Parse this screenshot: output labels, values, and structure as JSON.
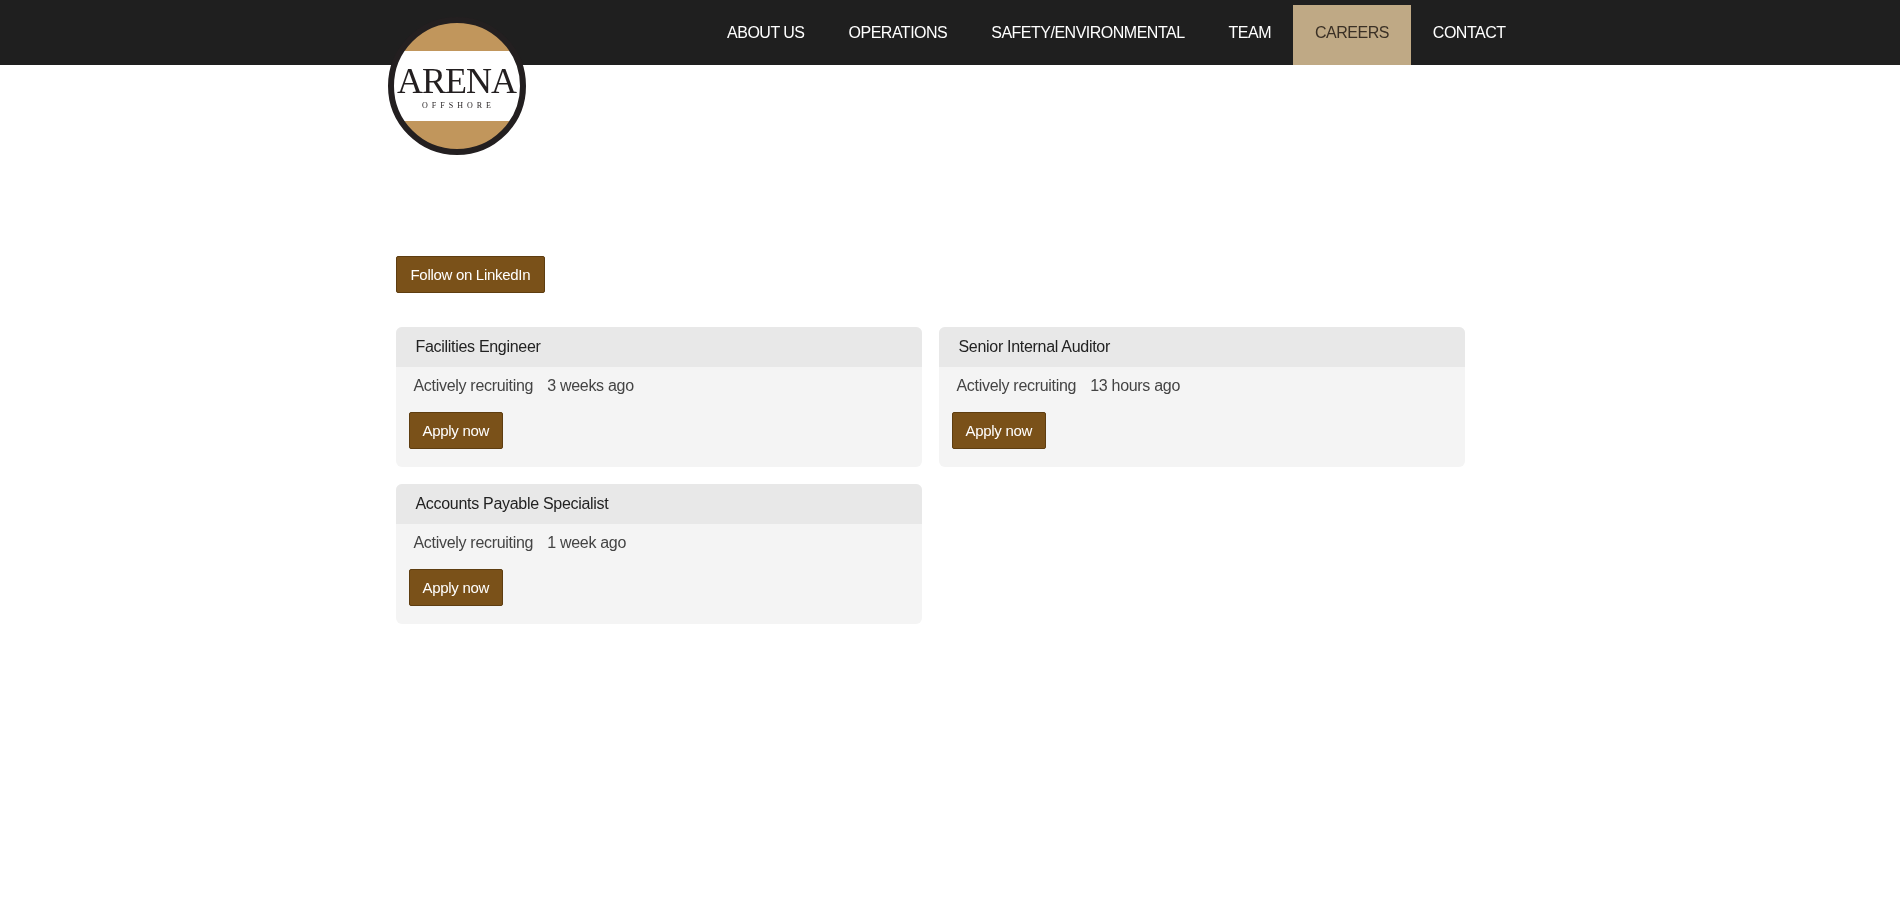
{
  "logo": {
    "name": "ARENA",
    "subtitle": "OFFSHORE"
  },
  "nav": [
    {
      "label": "ABOUT US",
      "selected": false
    },
    {
      "label": "OPERATIONS",
      "selected": false
    },
    {
      "label": "SAFETY/ENVIRONMENTAL",
      "selected": false
    },
    {
      "label": "TEAM",
      "selected": false
    },
    {
      "label": "CAREERS",
      "selected": true
    },
    {
      "label": "CONTACT",
      "selected": false
    }
  ],
  "follow_button": "Follow on LinkedIn",
  "jobs": [
    {
      "title": "Facilities Engineer",
      "status": "Actively recruiting",
      "posted": "3 weeks ago",
      "button": "Apply now"
    },
    {
      "title": "Senior Internal Auditor",
      "status": "Actively recruiting",
      "posted": "13 hours ago",
      "button": "Apply now"
    },
    {
      "title": "Accounts Payable Specialist",
      "status": "Actively recruiting",
      "posted": "1 week ago",
      "button": "Apply now"
    }
  ]
}
